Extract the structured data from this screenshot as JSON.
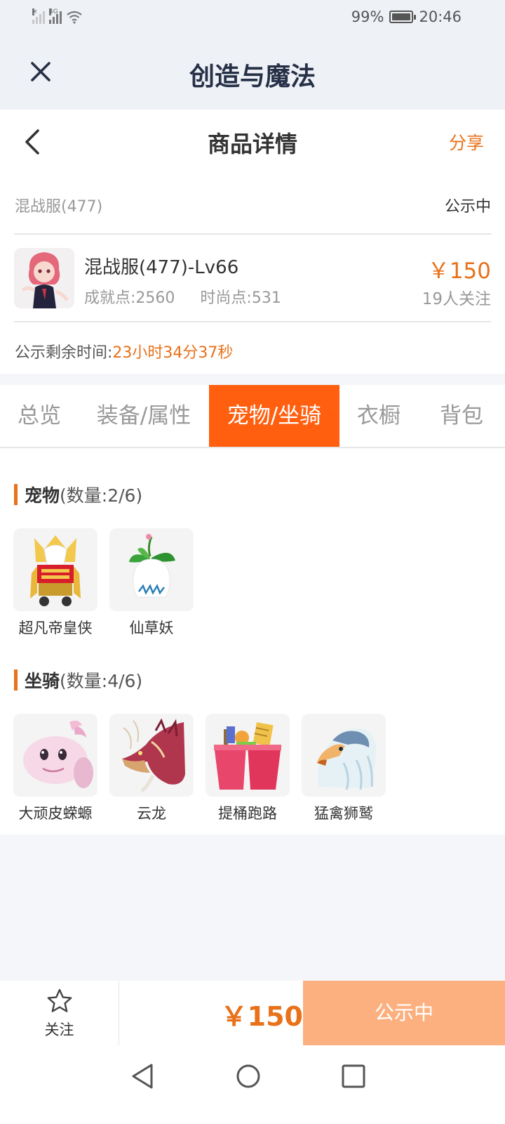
{
  "status_bar": {
    "signal1_tag": "×",
    "signal2_tag": "4G",
    "battery_percent": "99%",
    "battery_level": 0.99,
    "time": "20:46"
  },
  "app_header": {
    "title": "创造与魔法"
  },
  "page_header": {
    "title": "商品详情",
    "share_label": "分享"
  },
  "listing": {
    "server": "混战服(477)",
    "status": "公示中",
    "character_name": "混战服(477)-Lv66",
    "achievement": "成就点:2560",
    "fashion": "时尚点:531",
    "price": "￥150",
    "followers": "19人关注",
    "remaining_label": "公示剩余时间:",
    "remaining_value": "23小时34分37秒"
  },
  "tabs": [
    {
      "label": "总览"
    },
    {
      "label": "装备/属性"
    },
    {
      "label": "宠物/坐骑"
    },
    {
      "label": "衣橱"
    },
    {
      "label": "背包"
    }
  ],
  "pets": {
    "title": "宠物",
    "count": "(数量:2/6)",
    "items": [
      {
        "name": "超凡帝皇侠"
      },
      {
        "name": "仙草妖"
      }
    ]
  },
  "mounts": {
    "title": "坐骑",
    "count": "(数量:4/6)",
    "items": [
      {
        "name": "大顽皮蝾螈"
      },
      {
        "name": "云龙"
      },
      {
        "name": "提桶跑路"
      },
      {
        "name": "猛禽狮鹫"
      }
    ]
  },
  "bottom_bar": {
    "follow_label": "关注",
    "price": "￥150",
    "status_button": "公示中"
  },
  "colors": {
    "accent": "#e8711a",
    "tab_active": "#ff5f0f",
    "status_button": "#fdb07f"
  }
}
